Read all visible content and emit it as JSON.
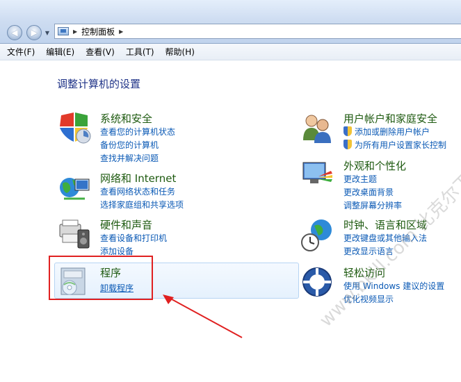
{
  "address": {
    "path": "控制面板"
  },
  "menu": [
    "文件(F)",
    "编辑(E)",
    "查看(V)",
    "工具(T)",
    "帮助(H)"
  ],
  "page_title": "调整计算机的设置",
  "left_categories": [
    {
      "title": "系统和安全",
      "links": [
        "查看您的计算机状态",
        "备份您的计算机",
        "查找并解决问题"
      ]
    },
    {
      "title": "网络和 Internet",
      "links": [
        "查看网络状态和任务",
        "选择家庭组和共享选项"
      ]
    },
    {
      "title": "硬件和声音",
      "links": [
        "查看设备和打印机",
        "添加设备"
      ]
    },
    {
      "title": "程序",
      "links": [
        "卸载程序"
      ]
    }
  ],
  "right_categories": [
    {
      "title": "用户帐户和家庭安全",
      "links": [
        "添加或删除用户帐户",
        "为所有用户设置家长控制"
      ]
    },
    {
      "title": "外观和个性化",
      "links": [
        "更改主题",
        "更改桌面背景",
        "调整屏幕分辨率"
      ]
    },
    {
      "title": "时钟、语言和区域",
      "links": [
        "更改键盘或其他输入法",
        "更改显示语言"
      ]
    },
    {
      "title": "轻松访问",
      "links": [
        "使用 Windows 建议的设置",
        "优化视频显示"
      ]
    }
  ],
  "watermark": "www.bkill.com 比克尔下载"
}
